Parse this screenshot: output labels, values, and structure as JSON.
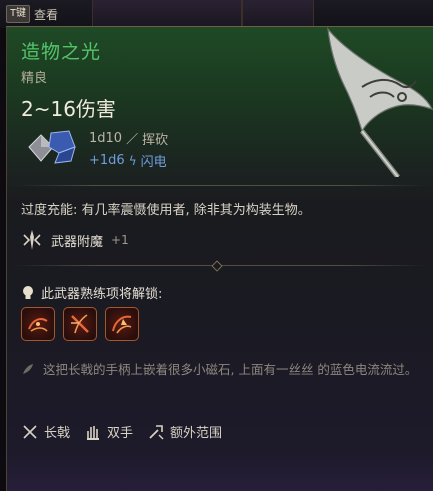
{
  "top_bar": {
    "key": "T键",
    "label": "查看"
  },
  "item": {
    "name": "造物之光",
    "rarity": "精良",
    "damage_total": "2~16伤害",
    "damage_lines": [
      {
        "dice": "1d10",
        "type": "挥砍",
        "icon": "slash-icon"
      },
      {
        "dice": "+1d6",
        "type": "闪电",
        "icon": "lightning-icon"
      }
    ]
  },
  "overcharge": "过度充能: 有几率震慑使用者, 除非其为构装生物。",
  "enchantment": {
    "label": "武器附魔",
    "bonus": "+1"
  },
  "proficiency": {
    "title": "此武器熟练项将解锁:",
    "actions": [
      "action-icon-1",
      "action-icon-2",
      "action-icon-3"
    ]
  },
  "lore": "这把长戟的手柄上嵌着很多小磁石, 上面有一丝丝 的蓝色电流流过。",
  "properties": [
    {
      "label": "长戟",
      "icon": "polearm-icon"
    },
    {
      "label": "双手",
      "icon": "two-handed-icon"
    },
    {
      "label": "额外范围",
      "icon": "reach-icon"
    }
  ],
  "colors": {
    "item_name": "#54c46a",
    "bonus_damage": "#6f9dde",
    "action_border": "#a4562f"
  }
}
